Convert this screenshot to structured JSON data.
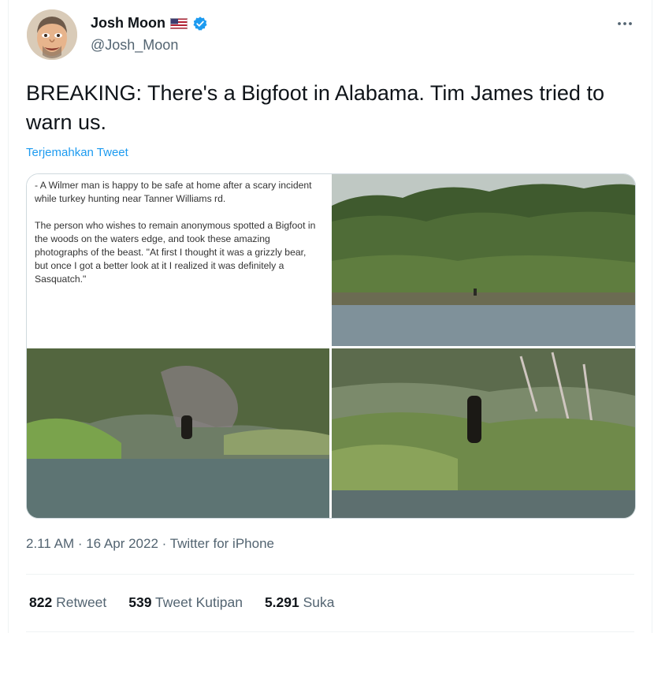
{
  "author": {
    "name": "Josh Moon",
    "handle": "@Josh_Moon",
    "flag_icon": "us-flag-icon",
    "verified_icon": "verified-badge-icon"
  },
  "tweet": {
    "text": "BREAKING: There's a Bigfoot in Alabama. Tim James tried to warn us.",
    "translate_label": "Terjemahkan Tweet",
    "article_paragraphs": [
      "- A Wilmer man is happy to be safe at home after a scary incident while turkey hunting near Tanner Williams rd.",
      "The person who wishes to remain anonymous spotted a Bigfoot in the woods on the waters edge, and took these amazing photographs of the beast. \"At first I thought it was a grizzly bear, but once I got a better look at it I realized it was definitely a Sasquatch.\""
    ],
    "meta": "2.11 AM · 16 Apr 2022 · Twitter for iPhone"
  },
  "stats": {
    "retweets_count": "822",
    "retweets_label": "Retweet",
    "quotes_count": "539",
    "quotes_label": "Tweet Kutipan",
    "likes_count": "5.291",
    "likes_label": "Suka"
  },
  "colors": {
    "link": "#1d9bf0",
    "secondary_text": "#536471",
    "verified": "#1d9bf0"
  }
}
